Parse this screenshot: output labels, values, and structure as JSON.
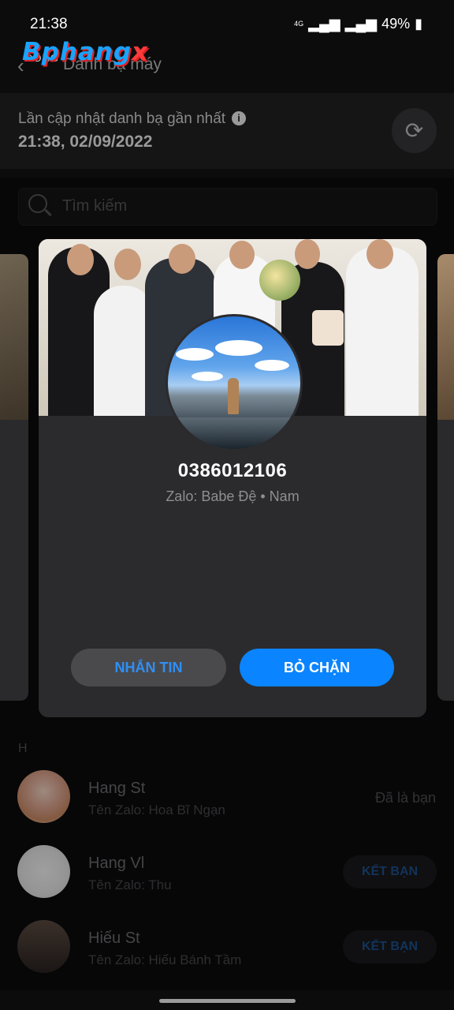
{
  "status_bar": {
    "time": "21:38",
    "network": "4G",
    "battery": "49%"
  },
  "watermark": {
    "text": "Bphang",
    "accent": "x"
  },
  "header": {
    "close_label": "ĐÓNG",
    "title": "Danh bạ máy"
  },
  "update_card": {
    "label": "Lần cập nhật danh bạ gần nhất",
    "info_icon": "i",
    "timestamp": "21:38, 02/09/2022"
  },
  "search": {
    "placeholder": "Tìm kiếm"
  },
  "profile_modal": {
    "phone": "0386012106",
    "subtitle": "Zalo: Babe Đệ • Nam",
    "message_button": "NHẮN TIN",
    "unblock_button": "BỎ CHẶN"
  },
  "section_letter": "H",
  "contacts": [
    {
      "name": "Hang St",
      "zalo_name": "Tên Zalo: Hoa Bĩ Ngạn",
      "status": "Đã là bạn"
    },
    {
      "name": "Hang Vl",
      "zalo_name": "Tên Zalo: Thu",
      "action": "KẾT BẠN"
    },
    {
      "name": "Hiếu St",
      "zalo_name": "Tên Zalo: Hiếu Bánh Tầm",
      "action": "KẾT BẠN"
    }
  ],
  "colors": {
    "accent": "#0a84ff",
    "background": "#0c0c0d",
    "modal": "#2b2b2d"
  }
}
